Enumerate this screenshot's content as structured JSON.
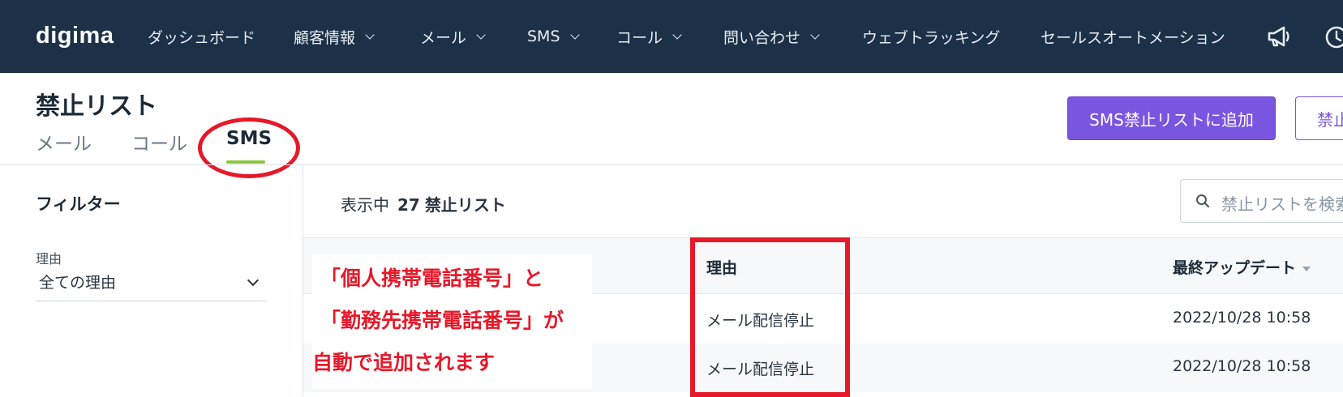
{
  "brand": {
    "logo_text": "digima",
    "accent": "#8cc63f",
    "nav_bg": "#1c3148"
  },
  "nav": {
    "items": [
      {
        "label": "ダッシュボード",
        "dropdown": false
      },
      {
        "label": "顧客情報",
        "dropdown": true
      },
      {
        "label": "メール",
        "dropdown": true
      },
      {
        "label": "SMS",
        "dropdown": true
      },
      {
        "label": "コール",
        "dropdown": true
      },
      {
        "label": "問い合わせ",
        "dropdown": true
      },
      {
        "label": "ウェブトラッキング",
        "dropdown": false
      },
      {
        "label": "セールスオートメーション",
        "dropdown": false
      }
    ],
    "icons": [
      "megaphone-icon",
      "clock-icon"
    ]
  },
  "page": {
    "title": "禁止リスト",
    "tabs": [
      {
        "label": "メール",
        "active": false
      },
      {
        "label": "コール",
        "active": false
      },
      {
        "label": "SMS",
        "active": true
      }
    ],
    "primary_button": "SMS禁止リストに追加",
    "secondary_button": "禁止"
  },
  "filter": {
    "title": "フィルター",
    "reason_label": "理由",
    "reason_value": "全ての理由"
  },
  "main": {
    "showing_prefix": "表示中",
    "count": "27",
    "unit": "禁止リスト",
    "search_placeholder": "禁止リストを検索"
  },
  "table": {
    "columns": {
      "reason": "理由",
      "updated": "最終アップデート"
    },
    "rows": [
      {
        "reason": "メール配信停止",
        "updated": "2022/10/28 10:58"
      },
      {
        "reason": "メール配信停止",
        "updated": "2022/10/28 10:58"
      }
    ]
  },
  "annotation": {
    "lines": [
      "「個人携帯電話番号」と",
      "「勤務先携帯電話番号」が",
      "自動で追加されます"
    ],
    "color": "#e6192a"
  },
  "colors": {
    "primary": "#7a55e0",
    "highlight": "#e6192a"
  }
}
